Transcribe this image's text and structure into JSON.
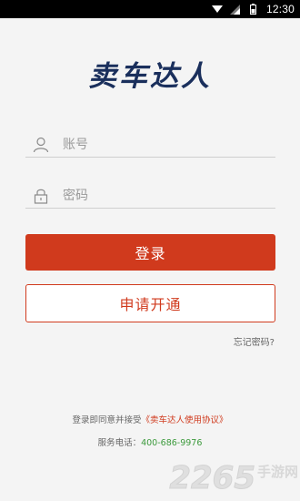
{
  "status_bar": {
    "time": "12:30",
    "icons": [
      "wifi-icon",
      "signal-icon",
      "battery-icon"
    ]
  },
  "logo": {
    "text": "卖车达人"
  },
  "form": {
    "username_placeholder": "账号",
    "password_placeholder": "密码",
    "login_label": "登录",
    "apply_label": "申请开通",
    "forgot_label": "忘记密码?"
  },
  "footer": {
    "agreement_prefix": "登录即同意并接受",
    "agreement_link": "《卖车达人使用协议》",
    "service_prefix": "服务电话：",
    "service_phone": "400-686-9976"
  },
  "watermark": {
    "number": "2265",
    "text": "手游网"
  },
  "colors": {
    "accent": "#d03a1d",
    "logo": "#1a2f5c",
    "phone": "#3c9a3c",
    "background": "#f4f4f4"
  }
}
